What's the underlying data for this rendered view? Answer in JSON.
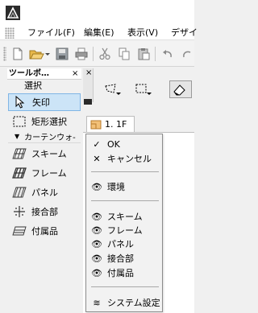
{
  "menubar": {
    "items": [
      {
        "label": "ファイル(F)"
      },
      {
        "label": "編集(E)"
      },
      {
        "label": "表示(V)"
      },
      {
        "label": "デザイ"
      }
    ]
  },
  "toolbox": {
    "title": "ツールボ…",
    "close": "×",
    "section": "選択",
    "tools": [
      {
        "label": "矢印",
        "icon": "arrow-pointer-icon",
        "selected": true
      },
      {
        "label": "矩形選択",
        "icon": "marquee-select-icon",
        "selected": false
      }
    ],
    "group": {
      "label": "カーテンウォ-",
      "arrow": "▼"
    },
    "group_tools": [
      {
        "label": "スキーム",
        "icon": "scheme-icon"
      },
      {
        "label": "フレーム",
        "icon": "frame-icon"
      },
      {
        "label": "パネル",
        "icon": "panel-icon"
      },
      {
        "label": "接合部",
        "icon": "junction-icon"
      },
      {
        "label": "付属品",
        "icon": "accessory-icon"
      }
    ]
  },
  "infobox": {
    "close": "×"
  },
  "tab": {
    "label": "1. 1F"
  },
  "context_menu": {
    "items": [
      {
        "label": "OK",
        "icon": "check-icon",
        "glyph": "✓"
      },
      {
        "label": "キャンセル",
        "icon": "cancel-x-icon",
        "glyph": "✕"
      },
      {
        "label": "環境",
        "icon": "eye-icon",
        "glyph": "👁"
      },
      {
        "label": "スキーム",
        "icon": "eye-scheme-icon",
        "glyph": "👁"
      },
      {
        "label": "フレーム",
        "icon": "eye-icon",
        "glyph": "👁"
      },
      {
        "label": "パネル",
        "icon": "eye-icon",
        "glyph": "👁"
      },
      {
        "label": "接合部",
        "icon": "eye-icon",
        "glyph": "👁"
      },
      {
        "label": "付属品",
        "icon": "eye-icon",
        "glyph": "👁"
      },
      {
        "label": "システム設定",
        "icon": "system-settings-icon",
        "glyph": "≋"
      }
    ]
  },
  "colors": {
    "selection_bg": "#cce4f7",
    "selection_border": "#80b5e5",
    "tab_icon": "#e8a040"
  }
}
